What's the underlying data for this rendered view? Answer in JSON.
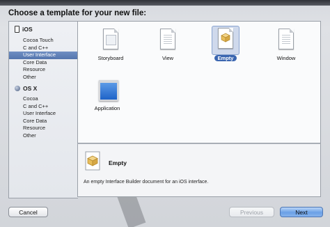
{
  "header": {
    "title": "Choose a template for your new file:"
  },
  "sidebar": {
    "sections": [
      {
        "label": "iOS",
        "icon": "iphone-icon",
        "items": [
          "Cocoa Touch",
          "C and C++",
          "User Interface",
          "Core Data",
          "Resource",
          "Other"
        ]
      },
      {
        "label": "OS X",
        "icon": "osx-icon",
        "items": [
          "Cocoa",
          "C and C++",
          "User Interface",
          "Core Data",
          "Resource",
          "Other"
        ]
      }
    ],
    "selected_section": "iOS",
    "selected_item": "User Interface"
  },
  "templates": [
    {
      "label": "Storyboard",
      "icon": "storyboard-icon",
      "selected": false
    },
    {
      "label": "View",
      "icon": "view-document-icon",
      "selected": false
    },
    {
      "label": "Empty",
      "icon": "empty-document-icon",
      "selected": true
    },
    {
      "label": "Window",
      "icon": "window-document-icon",
      "selected": false
    },
    {
      "label": "Application",
      "icon": "application-icon",
      "selected": false
    }
  ],
  "detail": {
    "title": "Empty",
    "description": "An empty Interface Builder document for an iOS interface."
  },
  "buttons": {
    "cancel": "Cancel",
    "previous": "Previous",
    "next": "Next"
  },
  "colors": {
    "selection": "#5475ad",
    "next_button": "#6aa0e6"
  }
}
